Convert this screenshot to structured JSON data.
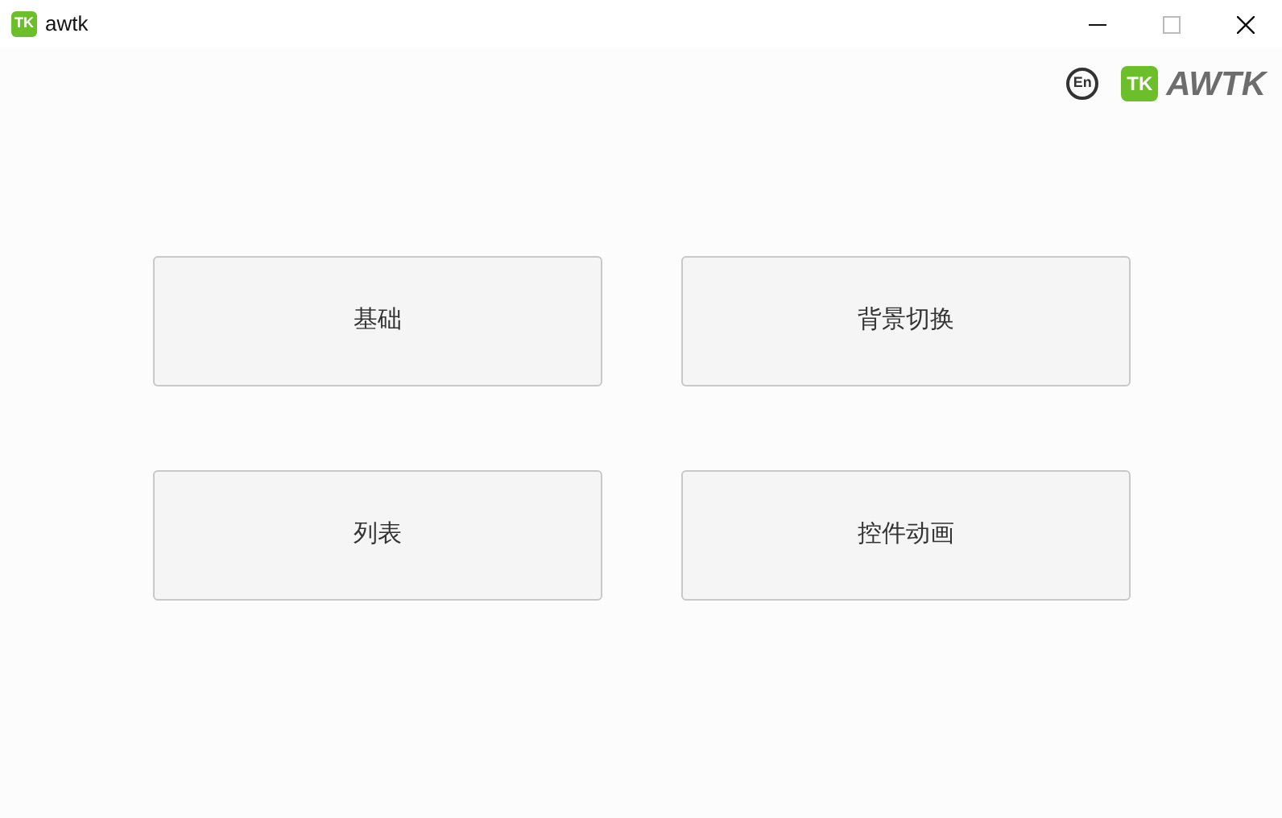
{
  "window": {
    "title": "awtk",
    "icon_text": "TK"
  },
  "header": {
    "language": "En",
    "logo_mark": "TK",
    "logo_text": "AWTK"
  },
  "buttons": [
    {
      "label": "基础"
    },
    {
      "label": "背景切换"
    },
    {
      "label": "列表"
    },
    {
      "label": "控件动画"
    }
  ]
}
